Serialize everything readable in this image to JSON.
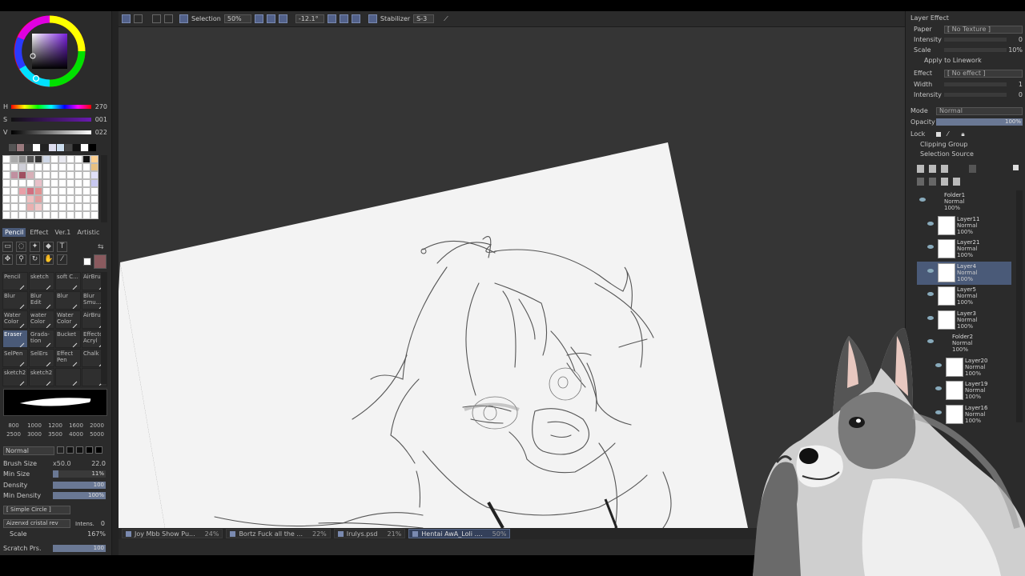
{
  "color": {
    "h_label": "H",
    "h_value": "270",
    "s_label": "S",
    "s_value": "001",
    "v_label": "V",
    "v_value": "022"
  },
  "tool_tabs": [
    {
      "label": "Pencil",
      "active": true
    },
    {
      "label": "Effect",
      "active": false
    },
    {
      "label": "Ver.1",
      "active": false
    },
    {
      "label": "Artistic",
      "active": false
    }
  ],
  "tools": [
    {
      "label": "Pencil",
      "active": false
    },
    {
      "label": "sketch",
      "active": false
    },
    {
      "label": "soft C...",
      "active": false
    },
    {
      "label": "AirBrush",
      "active": false
    },
    {
      "label": "Blur",
      "active": false
    },
    {
      "label": "Blur Edit",
      "active": false
    },
    {
      "label": "Blur",
      "active": false
    },
    {
      "label": "Blur Smu...",
      "active": false
    },
    {
      "label": "Water Color",
      "active": false
    },
    {
      "label": "water Color",
      "active": false
    },
    {
      "label": "Water Color",
      "active": false
    },
    {
      "label": "AirBrush",
      "active": false
    },
    {
      "label": "Eraser",
      "active": true
    },
    {
      "label": "Grada- tion",
      "active": false
    },
    {
      "label": "Bucket",
      "active": false
    },
    {
      "label": "Effectos Acryl",
      "active": false
    },
    {
      "label": "SelPen",
      "active": false
    },
    {
      "label": "SelErs",
      "active": false
    },
    {
      "label": "Effect Pen",
      "active": false
    },
    {
      "label": "Chalk",
      "active": false
    },
    {
      "label": "sketch2",
      "active": false
    },
    {
      "label": "sketch2",
      "active": false
    },
    {
      "label": "",
      "active": false
    },
    {
      "label": "",
      "active": false
    }
  ],
  "brush_sizes": [
    "800",
    "1000",
    "1200",
    "1600",
    "2000",
    "2500",
    "3000",
    "3500",
    "4000",
    "5000"
  ],
  "brush": {
    "blend_mode": "Normal",
    "size_label": "Brush Size",
    "size_mult": "x50.0",
    "size_value": "22.0",
    "min_size_label": "Min Size",
    "min_size_value": "11%",
    "min_size_fill": 0.11,
    "density_label": "Density",
    "density_value": "100",
    "density_fill": 1.0,
    "min_density_label": "Min Density",
    "min_density_value": "100%",
    "min_density_fill": 1.0,
    "shape": "[ Simple Circle ]",
    "texture": "Aizenxd cristal rev",
    "texture_intens_label": "Intens.",
    "texture_intens_value": "0",
    "scale_label": "Scale",
    "scale_value": "167%",
    "scratch_label": "Scratch Prs.",
    "scratch_value": "100",
    "scratch_fill": 1.0
  },
  "toolbar": {
    "selection_label": "Selection",
    "zoom": "50%",
    "rotation": "-12.1°",
    "stabilizer_label": "Stabilizer",
    "stabilizer_value": "S-3"
  },
  "file_tabs": [
    {
      "name": "Joy Mbb Show Pu...",
      "zoom": "24%",
      "active": false
    },
    {
      "name": "Bortz Fuck all the ...",
      "zoom": "22%",
      "active": false
    },
    {
      "name": "Irulys.psd",
      "zoom": "21%",
      "active": false
    },
    {
      "name": "Hentai AwA_Loli ....",
      "zoom": "50%",
      "active": true
    }
  ],
  "layer_effect": {
    "title": "Layer Effect",
    "paper_label": "Paper",
    "paper_value": "[ No Texture ]",
    "intensity_label": "Intensity",
    "intensity_value": "0",
    "scale_label": "Scale",
    "scale_value": "10%",
    "apply_linework": "Apply to Linework",
    "effect_label": "Effect",
    "effect_value": "[ No effect ]",
    "width_label": "Width",
    "width_value": "1",
    "intensity2_label": "Intensity",
    "intensity2_value": "0"
  },
  "layer_props": {
    "mode_label": "Mode",
    "mode_value": "Normal",
    "opacity_label": "Opacity",
    "opacity_value": "100%",
    "opacity_fill": 1.0,
    "lock_label": "Lock",
    "clipping_group": "Clipping Group",
    "selection_source": "Selection Source"
  },
  "layers": [
    {
      "name": "Folder1",
      "mode": "Normal",
      "opacity": "100%",
      "folder": true,
      "indent": 0,
      "selected": false
    },
    {
      "name": "Layer11",
      "mode": "Normal",
      "opacity": "100%",
      "folder": false,
      "indent": 1,
      "selected": false
    },
    {
      "name": "Layer21",
      "mode": "Normal",
      "opacity": "100%",
      "folder": false,
      "indent": 1,
      "selected": false
    },
    {
      "name": "Layer4",
      "mode": "Normal",
      "opacity": "100%",
      "folder": false,
      "indent": 1,
      "selected": true
    },
    {
      "name": "Layer5",
      "mode": "Normal",
      "opacity": "100%",
      "folder": false,
      "indent": 1,
      "selected": false
    },
    {
      "name": "Layer3",
      "mode": "Normal",
      "opacity": "100%",
      "folder": false,
      "indent": 1,
      "selected": false
    },
    {
      "name": "Folder2",
      "mode": "Normal",
      "opacity": "100%",
      "folder": true,
      "indent": 1,
      "selected": false
    },
    {
      "name": "Layer20",
      "mode": "Normal",
      "opacity": "100%",
      "folder": false,
      "indent": 2,
      "selected": false
    },
    {
      "name": "Layer19",
      "mode": "Normal",
      "opacity": "100%",
      "folder": false,
      "indent": 2,
      "selected": false
    },
    {
      "name": "Layer16",
      "mode": "Normal",
      "opacity": "100%",
      "folder": false,
      "indent": 2,
      "selected": false
    }
  ],
  "colors": {
    "accent": "#4a5a78",
    "panel": "#2b2b2b",
    "canvas_bg": "#353535",
    "paper": "#f3f3f3",
    "current_color": "#8a5a5e"
  }
}
